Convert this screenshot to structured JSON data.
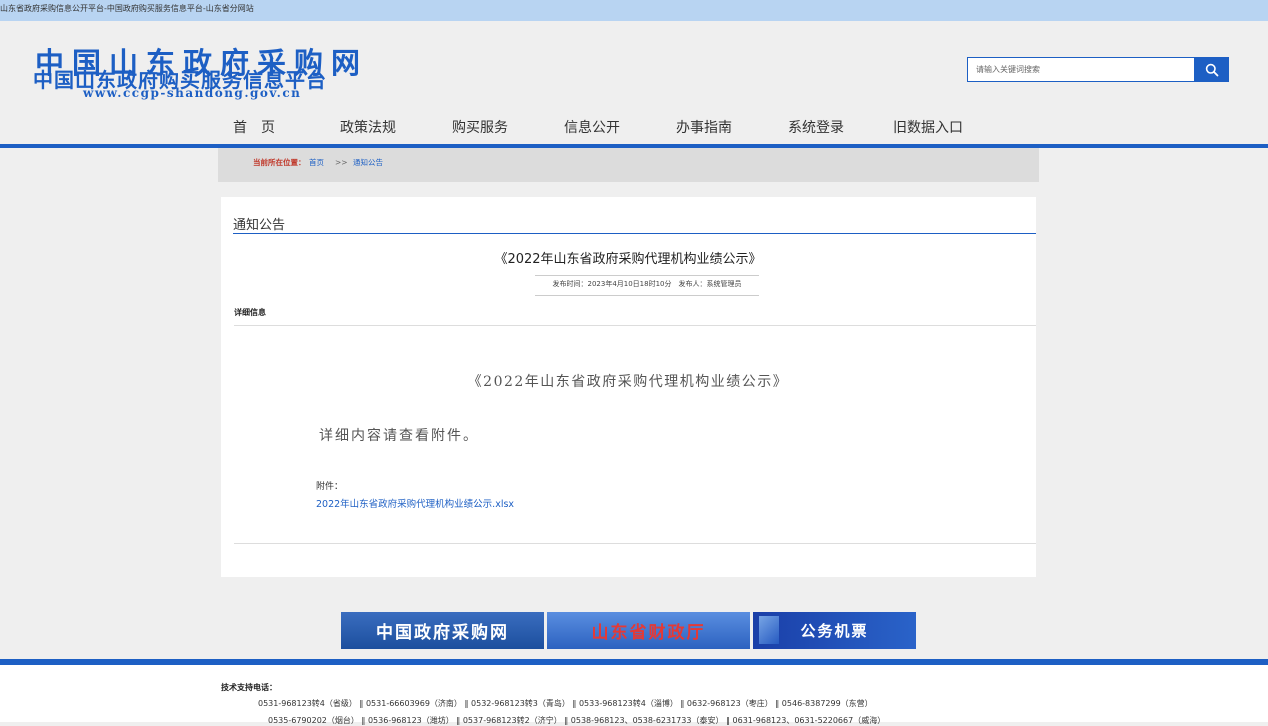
{
  "window": {
    "title": "山东省政府采购信息公开平台-中国政府购买服务信息平台-山东省分网站"
  },
  "logo": {
    "line1": "中国山东政府采购网",
    "line2": "中国山东政府购买服务信息平台",
    "line3": "www.ccgp-shandong.gov.cn"
  },
  "search": {
    "placeholder": "请输入关键词搜索",
    "icon": "search-icon"
  },
  "nav": {
    "items": [
      "首　页",
      "政策法规",
      "购买服务",
      "信息公开",
      "办事指南",
      "系统登录",
      "旧数据入口"
    ]
  },
  "breadcrumb": {
    "label": "当前所在位置：",
    "home": "首页",
    "separator": ">>",
    "current": "通知公告"
  },
  "section": {
    "title": "通知公告"
  },
  "article": {
    "title": "《2022年山东省政府采购代理机构业绩公示》",
    "meta": "发布时间：2023年4月10日18时10分　发布人：系统管理员",
    "detail_label": "详细信息",
    "body_title": "《2022年山东省政府采购代理机构业绩公示》",
    "body_text": "详细内容请查看附件。",
    "attachment_label": "附件：",
    "attachment_link": "2022年山东省政府采购代理机构业绩公示.xlsx"
  },
  "banners": {
    "b1": "中国政府采购网",
    "b2": "山东省财政厅",
    "b3": "公务机票"
  },
  "footer": {
    "support_label": "技术支持电话：",
    "phones_line1": "0531-968123转4（省级） ‖ 0531-66603969（济南） ‖ 0532-968123转3（青岛） ‖ 0533-968123转4（淄博） ‖ 0632-968123（枣庄） ‖ 0546-8387299（东营）",
    "phones_line2": "0535-6790202（烟台） ‖ 0536-968123（潍坊） ‖ 0537-968123转2（济宁） ‖ 0538-968123、0538-6231733（泰安） ‖ 0631-968123、0631-5220667（威海）"
  },
  "colors": {
    "brand_blue": "#1d5fc4",
    "breadcrumb_label_red": "#c0392b",
    "topbar": "#b8d4f2"
  }
}
